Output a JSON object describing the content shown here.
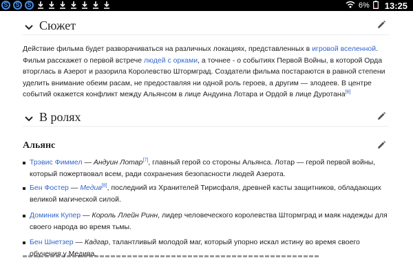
{
  "status_bar": {
    "app_icons": [
      "S",
      "S",
      "S"
    ],
    "battery": "6%",
    "time": "13:25",
    "colors": {
      "background": "#000000",
      "app_icon": "#4a8fe7"
    }
  },
  "sections": {
    "plot": {
      "title": "Сюжет",
      "paragraph": {
        "t1": "Действие фильма будет разворачиваться на различных локациях, представленных в ",
        "link1": "игровой вселенной",
        "t2": ". Фильм расскажет о первой встрече ",
        "link2": "людей с орками",
        "t3": ", а точнее - о событиях Первой Войны, в которой Орда вторглась в Азерот и разорила Королевство Штормград. Создатели фильма постараются в равной степени уделить внимание обеим расам, не предоставляя ни одной роль героев, а другим — злодеев. В центре событий окажется конфликт между Альянсом в лице Андуина Лотара и Ордой в лице Дуротана",
        "ref": "[6]"
      }
    },
    "cast": {
      "title": "В ролях",
      "alliance": {
        "title": "Альянс",
        "items": [
          {
            "actor": "Трэвис Фиммел",
            "sep": " — ",
            "role": "Андуин Лотар",
            "ref": "[7]",
            "desc": ", главный герой со стороны Альянса. Лотар — герой первой войны, который пожертвовал всем, ради сохранения безопасности людей Азерота."
          },
          {
            "actor": "Бен Фостер",
            "sep": " — ",
            "role": "Медив",
            "ref": "[8]",
            "desc": ", последний из Хранителей Тирисфаля, древней касты защитников, обладающих великой магической силой."
          },
          {
            "actor": "Доминик Купер",
            "sep": " — ",
            "role": "Король Ллейн Ринн",
            "ref": "",
            "desc": ", лидер человеческого королевства Штормград и маяк надежды для своего народа во время тьмы."
          },
          {
            "actor": "Бен Шнетзер",
            "sep": " — ",
            "role": "Кадгар",
            "ref": "",
            "desc": ", талантливый молодой маг, который упорно искал истину во время своего обучения у Медива."
          }
        ]
      }
    }
  },
  "colors": {
    "link": "#3366cc",
    "text": "#222222",
    "divider": "#eaecf0"
  }
}
